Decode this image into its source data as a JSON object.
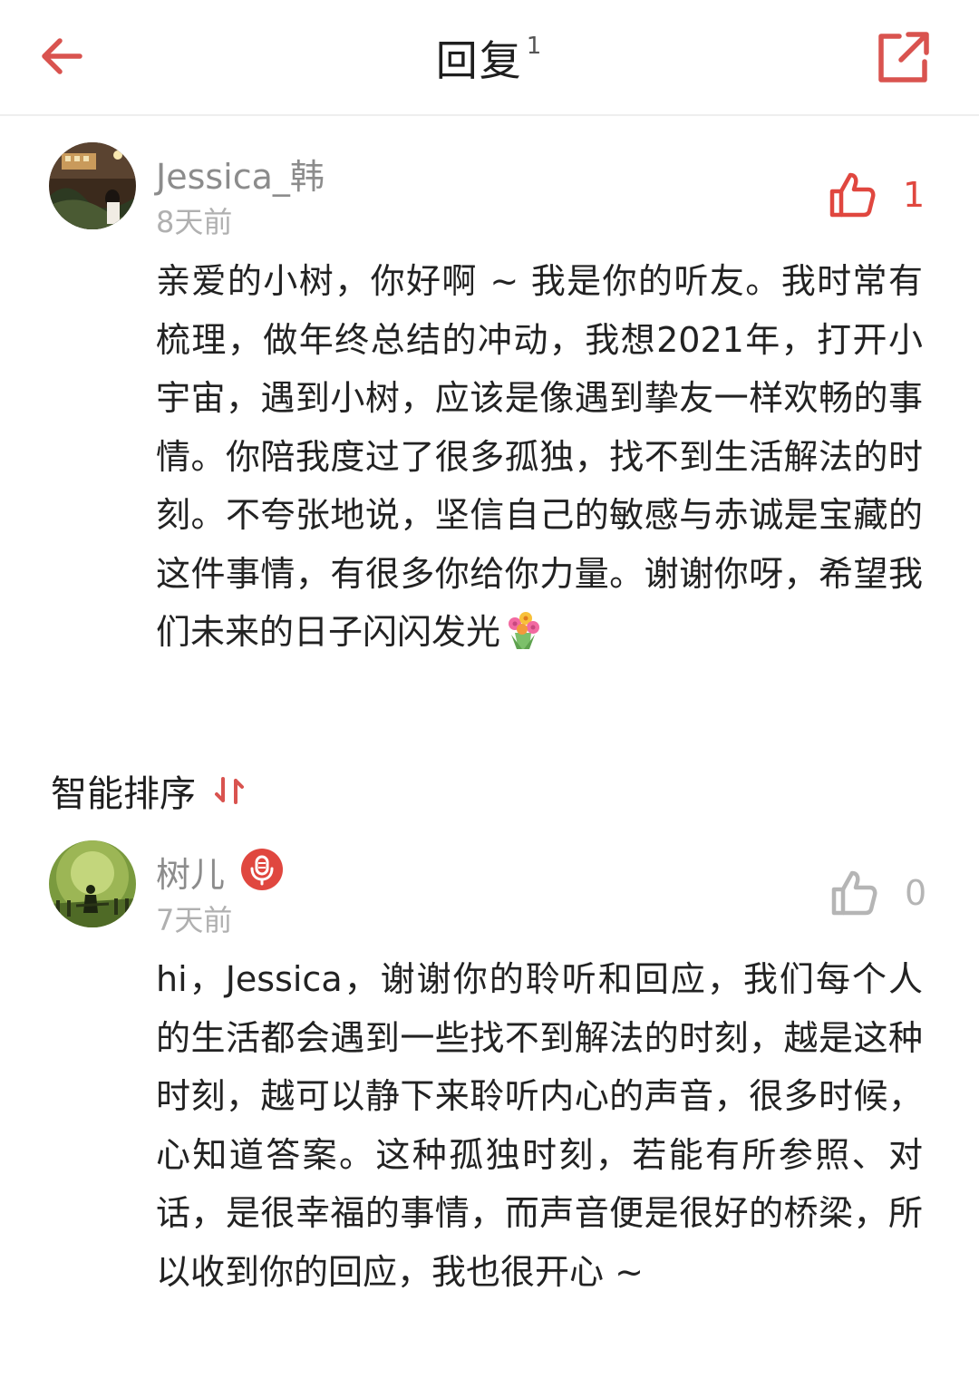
{
  "header": {
    "title": "回复",
    "count": "1",
    "back_icon": "arrow-left-icon",
    "share_icon": "share-external-icon",
    "accent_color": "#d9534f"
  },
  "main_comment": {
    "username": "Jessica_韩",
    "time": "8天前",
    "likes": "1",
    "text": "亲爱的小树，你好啊 ~ 我是你的听友。我时常有梳理，做年终总结的冲动，我想2021年，打开小宇宙，遇到小树，应该是像遇到挚友一样欢畅的事情。你陪我度过了很多孤独，找不到生活解法的时刻。不夸张地说，坚信自己的敏感与赤诚是宝藏的这件事情，有很多你给你力量。谢谢你呀，希望我们未来的日子闪闪发光",
    "emoji": "bouquet-emoji"
  },
  "sort": {
    "label": "智能排序",
    "icon": "sort-arrows-icon"
  },
  "replies": [
    {
      "username": "树儿",
      "badge": "microphone-badge-icon",
      "time": "7天前",
      "likes": "0",
      "text": "hi，Jessica，谢谢你的聆听和回应，我们每个人的生活都会遇到一些找不到解法的时刻，越是这种时刻，越可以静下来聆听内心的声音，很多时候，心知道答案。这种孤独时刻，若能有所参照、对话，是很幸福的事情，而声音便是很好的桥梁，所以收到你的回应，我也很开心 ~"
    }
  ],
  "colors": {
    "accent": "#d9534f",
    "liked": "#e0473f",
    "like_neutral": "#b5b5b5",
    "secondary_text": "#8c8c8c"
  }
}
